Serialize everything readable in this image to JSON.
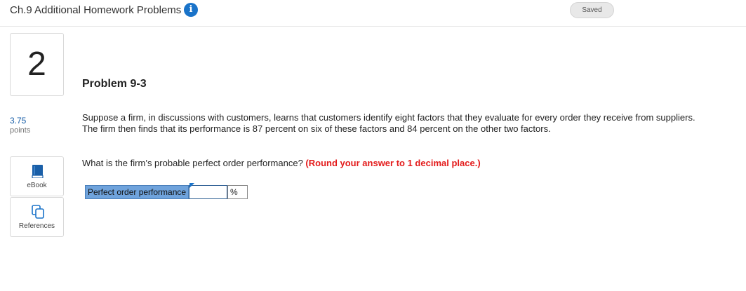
{
  "header": {
    "title": "Ch.9 Additional Homework Problems",
    "info_icon": "info-icon",
    "saved_label": "Saved"
  },
  "question": {
    "number": "2",
    "points_value": "3.75",
    "points_label": "points"
  },
  "side_tools": [
    {
      "label": "eBook",
      "icon": "book-icon"
    },
    {
      "label": "References",
      "icon": "copy-icon"
    }
  ],
  "problem": {
    "title": "Problem 9-3",
    "text": "Suppose a firm, in discussions with customers, learns that customers identify eight factors that they evaluate for every order they receive from suppliers. The firm then finds that its performance is 87 percent on six of these factors and 84 percent on the other two factors.",
    "question": "What is the firm’s probable perfect order performance?",
    "instruction": "(Round your answer to 1 decimal place.)"
  },
  "answer": {
    "label": "Perfect order performance",
    "value": "",
    "unit": "%"
  },
  "colors": {
    "accent_blue": "#1a73c9",
    "label_blue": "#6fa3dc",
    "instruction_red": "#e31a1a"
  }
}
